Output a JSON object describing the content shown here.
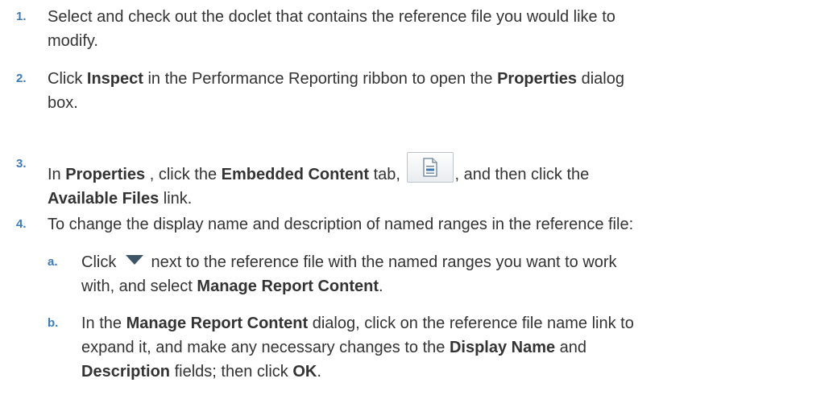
{
  "steps": [
    {
      "num": "1.",
      "lines": [
        "Select and check out the doclet that contains the reference file you would like to",
        "modify."
      ]
    },
    {
      "num": "2.",
      "pre": "Click ",
      "b1": "Inspect",
      "mid": " in the Performance Reporting ribbon to open the ",
      "b2": "Properties",
      "post": " dialog",
      "line2": "box."
    },
    {
      "num": "3.",
      "pre": "In ",
      "b1": "Properties",
      "mid1": " , click the ",
      "b2": "Embedded Content",
      "mid2": " tab, ",
      "post": ", and then click the",
      "b3": "Available Files",
      "post2": " link.",
      "icon": "embedded-content-icon"
    },
    {
      "num": "4.",
      "text": "To change the display name and description of named ranges in the reference file:"
    }
  ],
  "substeps": [
    {
      "num": "a.",
      "pre": "Click ",
      "icon": "dropdown-arrow-icon",
      "mid": " next to the reference file with the named ranges you want to work",
      "line2_pre": "with, and select ",
      "b1": "Manage Report Content",
      "line2_post": "."
    },
    {
      "num": "b.",
      "pre": "In the ",
      "b1": "Manage Report Content",
      "mid": " dialog, click on the reference file name link to",
      "line2_pre": "expand it, and make any necessary changes to the ",
      "b2": "Display Name",
      "line2_post": " and",
      "b3": "Description",
      "line3_mid": " fields; then click ",
      "b4": "OK",
      "line3_post": "."
    }
  ],
  "colors": {
    "number": "#3a7bbf",
    "text": "#333333",
    "arrow": "#3f5568"
  }
}
